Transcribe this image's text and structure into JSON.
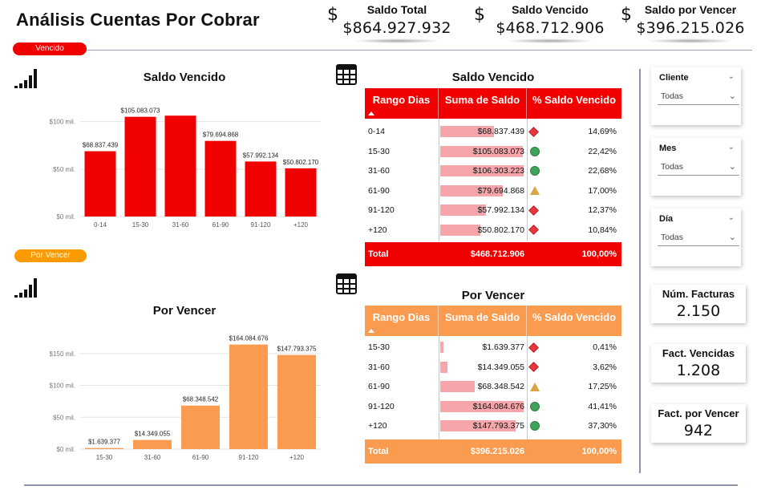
{
  "header": {
    "title": "Análisis Cuentas Por Cobrar",
    "dollar_symbol": "$",
    "kpis": [
      {
        "label": "Saldo Total",
        "value": "$864.927.932"
      },
      {
        "label": "Saldo Vencido",
        "value": "$468.712.906"
      },
      {
        "label": "Saldo por Vencer",
        "value": "$396.215.026"
      }
    ]
  },
  "sections": {
    "vencido_pill": "Vencido",
    "por_vencer_pill": "Por Vencer"
  },
  "colors": {
    "vencido": "#f00000",
    "por_vencer": "#fb9b4f",
    "ok": "#3fa45a",
    "warn": "#d9a441",
    "bad": "#e8383d",
    "databar": "#f6a6aa"
  },
  "chart_data": [
    {
      "type": "bar",
      "title": "Saldo Vencido",
      "categories": [
        "0-14",
        "15-30",
        "31-60",
        "61-90",
        "91-120",
        "+120"
      ],
      "values": [
        68837439,
        105083073,
        106303223,
        79694868,
        57992134,
        50802170
      ],
      "data_labels": [
        "$68.837.439",
        "$105.083.073",
        "",
        "$79.694.868",
        "$57.992.134",
        "$50.802.170"
      ],
      "y_ticks": [
        {
          "v": 0,
          "label": "$0 mil."
        },
        {
          "v": 50000000,
          "label": "$50 mil."
        },
        {
          "v": 100000000,
          "label": "$100 mil."
        }
      ],
      "ylim": [
        0,
        120000000
      ],
      "color": "#f00000"
    },
    {
      "type": "bar",
      "title": "Por Vencer",
      "categories": [
        "15-30",
        "31-60",
        "61-90",
        "91-120",
        "+120"
      ],
      "values": [
        1639377,
        14349055,
        68348542,
        164084676,
        147793375
      ],
      "data_labels": [
        "$1.639.377",
        "$14.349.055",
        "$68.348.542",
        "$164.084.676",
        "$147.793.375"
      ],
      "y_ticks": [
        {
          "v": 0,
          "label": "$0 mil."
        },
        {
          "v": 50000000,
          "label": "$50 mil."
        },
        {
          "v": 100000000,
          "label": "$100 mil."
        },
        {
          "v": 150000000,
          "label": "$150 mil."
        }
      ],
      "ylim": [
        0,
        180000000
      ],
      "color": "#fb9b4f"
    }
  ],
  "table_vencido": {
    "title": "Saldo Vencido",
    "columns": [
      "Rango Dias",
      "Suma de Saldo",
      "% Saldo Vencido"
    ],
    "rows": [
      {
        "rango": "0-14",
        "saldo": "$68.837.439",
        "share": 0.6475,
        "status": "diamond",
        "pct": "14,69%"
      },
      {
        "rango": "15-30",
        "saldo": "$105.083.073",
        "share": 0.9885,
        "status": "circle",
        "pct": "22,42%"
      },
      {
        "rango": "31-60",
        "saldo": "$106.303.223",
        "share": 1.0,
        "status": "circle",
        "pct": "22,68%"
      },
      {
        "rango": "61-90",
        "saldo": "$79.694.868",
        "share": 0.7497,
        "status": "triangle",
        "pct": "17,00%"
      },
      {
        "rango": "91-120",
        "saldo": "$57.992.134",
        "share": 0.5455,
        "status": "diamond",
        "pct": "12,37%"
      },
      {
        "rango": "+120",
        "saldo": "$50.802.170",
        "share": 0.4779,
        "status": "diamond",
        "pct": "10,84%"
      }
    ],
    "total": {
      "label": "Total",
      "saldo": "$468.712.906",
      "pct": "100,00%"
    }
  },
  "table_por_vencer": {
    "title": "Por Vencer",
    "columns": [
      "Rango Dias",
      "Suma de Saldo",
      "% Saldo Vencido"
    ],
    "rows": [
      {
        "rango": "15-30",
        "saldo": "$1.639.377",
        "share": 0.01,
        "status": "diamond",
        "pct": "0,41%"
      },
      {
        "rango": "31-60",
        "saldo": "$14.349.055",
        "share": 0.0874,
        "status": "diamond",
        "pct": "3,62%"
      },
      {
        "rango": "61-90",
        "saldo": "$68.348.542",
        "share": 0.4165,
        "status": "triangle",
        "pct": "17,25%"
      },
      {
        "rango": "91-120",
        "saldo": "$164.084.676",
        "share": 1.0,
        "status": "circle",
        "pct": "41,41%"
      },
      {
        "rango": "+120",
        "saldo": "$147.793.375",
        "share": 0.9007,
        "status": "circle",
        "pct": "37,30%"
      }
    ],
    "total": {
      "label": "Total",
      "saldo": "$396.215.026",
      "pct": "100,00%"
    }
  },
  "slicers": [
    {
      "label": "Cliente",
      "value": "Todas"
    },
    {
      "label": "Mes",
      "value": "Todas"
    },
    {
      "label": "Día",
      "value": "Todas"
    }
  ],
  "cards": [
    {
      "label": "Núm. Facturas",
      "value": "2.150"
    },
    {
      "label": "Fact. Vencidas",
      "value": "1.208"
    },
    {
      "label": "Fact. por Vencer",
      "value": "942"
    }
  ]
}
